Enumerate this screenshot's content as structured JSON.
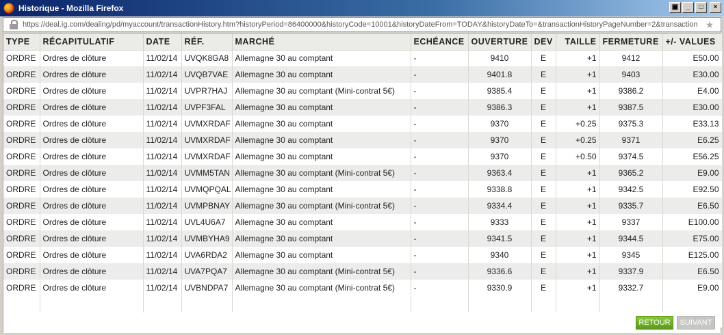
{
  "window": {
    "title": "Historique - Mozilla Firefox",
    "controls": {
      "restore": "▣",
      "minimize": "_",
      "maximize": "□",
      "close": "×"
    }
  },
  "urlbar": {
    "url": "https://deal.ig.com/dealing/pd/myaccount/transactionHistory.htm?historyPeriod=86400000&historyCode=10001&historyDateFrom=TODAY&historyDateTo=&transactionHistoryPageNumber=2&transaction"
  },
  "table": {
    "headers": {
      "type": "TYPE",
      "recap": "RÉCAPITULATIF",
      "date": "DATE",
      "ref": "RÉF.",
      "marche": "MARCHÉ",
      "echeance": "ECHÉANCE",
      "ouverture": "OUVERTURE",
      "dev": "DEV",
      "taille": "TAILLE",
      "fermeture": "FERMETURE",
      "values": "+/- VALUES"
    },
    "rows": [
      {
        "type": "ORDRE",
        "recap": "Ordres de clôture",
        "date": "11/02/14",
        "ref": "UVQK8GA8",
        "marche": "Allemagne 30 au comptant",
        "echeance": "-",
        "ouverture": "9410",
        "dev": "E",
        "taille": "+1",
        "fermeture": "9412",
        "values": "E50.00"
      },
      {
        "type": "ORDRE",
        "recap": "Ordres de clôture",
        "date": "11/02/14",
        "ref": "UVQB7VAE",
        "marche": "Allemagne 30 au comptant",
        "echeance": "-",
        "ouverture": "9401.8",
        "dev": "E",
        "taille": "+1",
        "fermeture": "9403",
        "values": "E30.00"
      },
      {
        "type": "ORDRE",
        "recap": "Ordres de clôture",
        "date": "11/02/14",
        "ref": "UVPR7HAJ",
        "marche": "Allemagne 30 au comptant (Mini-contrat 5€)",
        "echeance": "-",
        "ouverture": "9385.4",
        "dev": "E",
        "taille": "+1",
        "fermeture": "9386.2",
        "values": "E4.00"
      },
      {
        "type": "ORDRE",
        "recap": "Ordres de clôture",
        "date": "11/02/14",
        "ref": "UVPF3FAL",
        "marche": "Allemagne 30 au comptant",
        "echeance": "-",
        "ouverture": "9386.3",
        "dev": "E",
        "taille": "+1",
        "fermeture": "9387.5",
        "values": "E30.00"
      },
      {
        "type": "ORDRE",
        "recap": "Ordres de clôture",
        "date": "11/02/14",
        "ref": "UVMXRDAF",
        "marche": "Allemagne 30 au comptant",
        "echeance": "-",
        "ouverture": "9370",
        "dev": "E",
        "taille": "+0.25",
        "fermeture": "9375.3",
        "values": "E33.13"
      },
      {
        "type": "ORDRE",
        "recap": "Ordres de clôture",
        "date": "11/02/14",
        "ref": "UVMXRDAF",
        "marche": "Allemagne 30 au comptant",
        "echeance": "-",
        "ouverture": "9370",
        "dev": "E",
        "taille": "+0.25",
        "fermeture": "9371",
        "values": "E6.25"
      },
      {
        "type": "ORDRE",
        "recap": "Ordres de clôture",
        "date": "11/02/14",
        "ref": "UVMXRDAF",
        "marche": "Allemagne 30 au comptant",
        "echeance": "-",
        "ouverture": "9370",
        "dev": "E",
        "taille": "+0.50",
        "fermeture": "9374.5",
        "values": "E56.25"
      },
      {
        "type": "ORDRE",
        "recap": "Ordres de clôture",
        "date": "11/02/14",
        "ref": "UVMM5TAN",
        "marche": "Allemagne 30 au comptant (Mini-contrat 5€)",
        "echeance": "-",
        "ouverture": "9363.4",
        "dev": "E",
        "taille": "+1",
        "fermeture": "9365.2",
        "values": "E9.00"
      },
      {
        "type": "ORDRE",
        "recap": "Ordres de clôture",
        "date": "11/02/14",
        "ref": "UVMQPQAL",
        "marche": "Allemagne 30 au comptant",
        "echeance": "-",
        "ouverture": "9338.8",
        "dev": "E",
        "taille": "+1",
        "fermeture": "9342.5",
        "values": "E92.50"
      },
      {
        "type": "ORDRE",
        "recap": "Ordres de clôture",
        "date": "11/02/14",
        "ref": "UVMPBNAY",
        "marche": "Allemagne 30 au comptant (Mini-contrat 5€)",
        "echeance": "-",
        "ouverture": "9334.4",
        "dev": "E",
        "taille": "+1",
        "fermeture": "9335.7",
        "values": "E6.50"
      },
      {
        "type": "ORDRE",
        "recap": "Ordres de clôture",
        "date": "11/02/14",
        "ref": "UVL4U6A7",
        "marche": "Allemagne 30 au comptant",
        "echeance": "-",
        "ouverture": "9333",
        "dev": "E",
        "taille": "+1",
        "fermeture": "9337",
        "values": "E100.00"
      },
      {
        "type": "ORDRE",
        "recap": "Ordres de clôture",
        "date": "11/02/14",
        "ref": "UVMBYHA9",
        "marche": "Allemagne 30 au comptant",
        "echeance": "-",
        "ouverture": "9341.5",
        "dev": "E",
        "taille": "+1",
        "fermeture": "9344.5",
        "values": "E75.00"
      },
      {
        "type": "ORDRE",
        "recap": "Ordres de clôture",
        "date": "11/02/14",
        "ref": "UVA6RDA2",
        "marche": "Allemagne 30 au comptant",
        "echeance": "-",
        "ouverture": "9340",
        "dev": "E",
        "taille": "+1",
        "fermeture": "9345",
        "values": "E125.00"
      },
      {
        "type": "ORDRE",
        "recap": "Ordres de clôture",
        "date": "11/02/14",
        "ref": "UVA7PQA7",
        "marche": "Allemagne 30 au comptant (Mini-contrat 5€)",
        "echeance": "-",
        "ouverture": "9336.6",
        "dev": "E",
        "taille": "+1",
        "fermeture": "9337.9",
        "values": "E6.50"
      },
      {
        "type": "ORDRE",
        "recap": "Ordres de clôture",
        "date": "11/02/14",
        "ref": "UVBNDPA7",
        "marche": "Allemagne 30 au comptant (Mini-contrat 5€)",
        "echeance": "-",
        "ouverture": "9330.9",
        "dev": "E",
        "taille": "+1",
        "fermeture": "9332.7",
        "values": "E9.00"
      }
    ]
  },
  "footer": {
    "retour_label": "RETOUR",
    "suivant_label": "SUIVANT"
  },
  "colors": {
    "titlebar": "#0a246a",
    "row_alt": "#ececea",
    "retour_button": "#6aa82a",
    "suivant_button": "#c6c6c4"
  }
}
